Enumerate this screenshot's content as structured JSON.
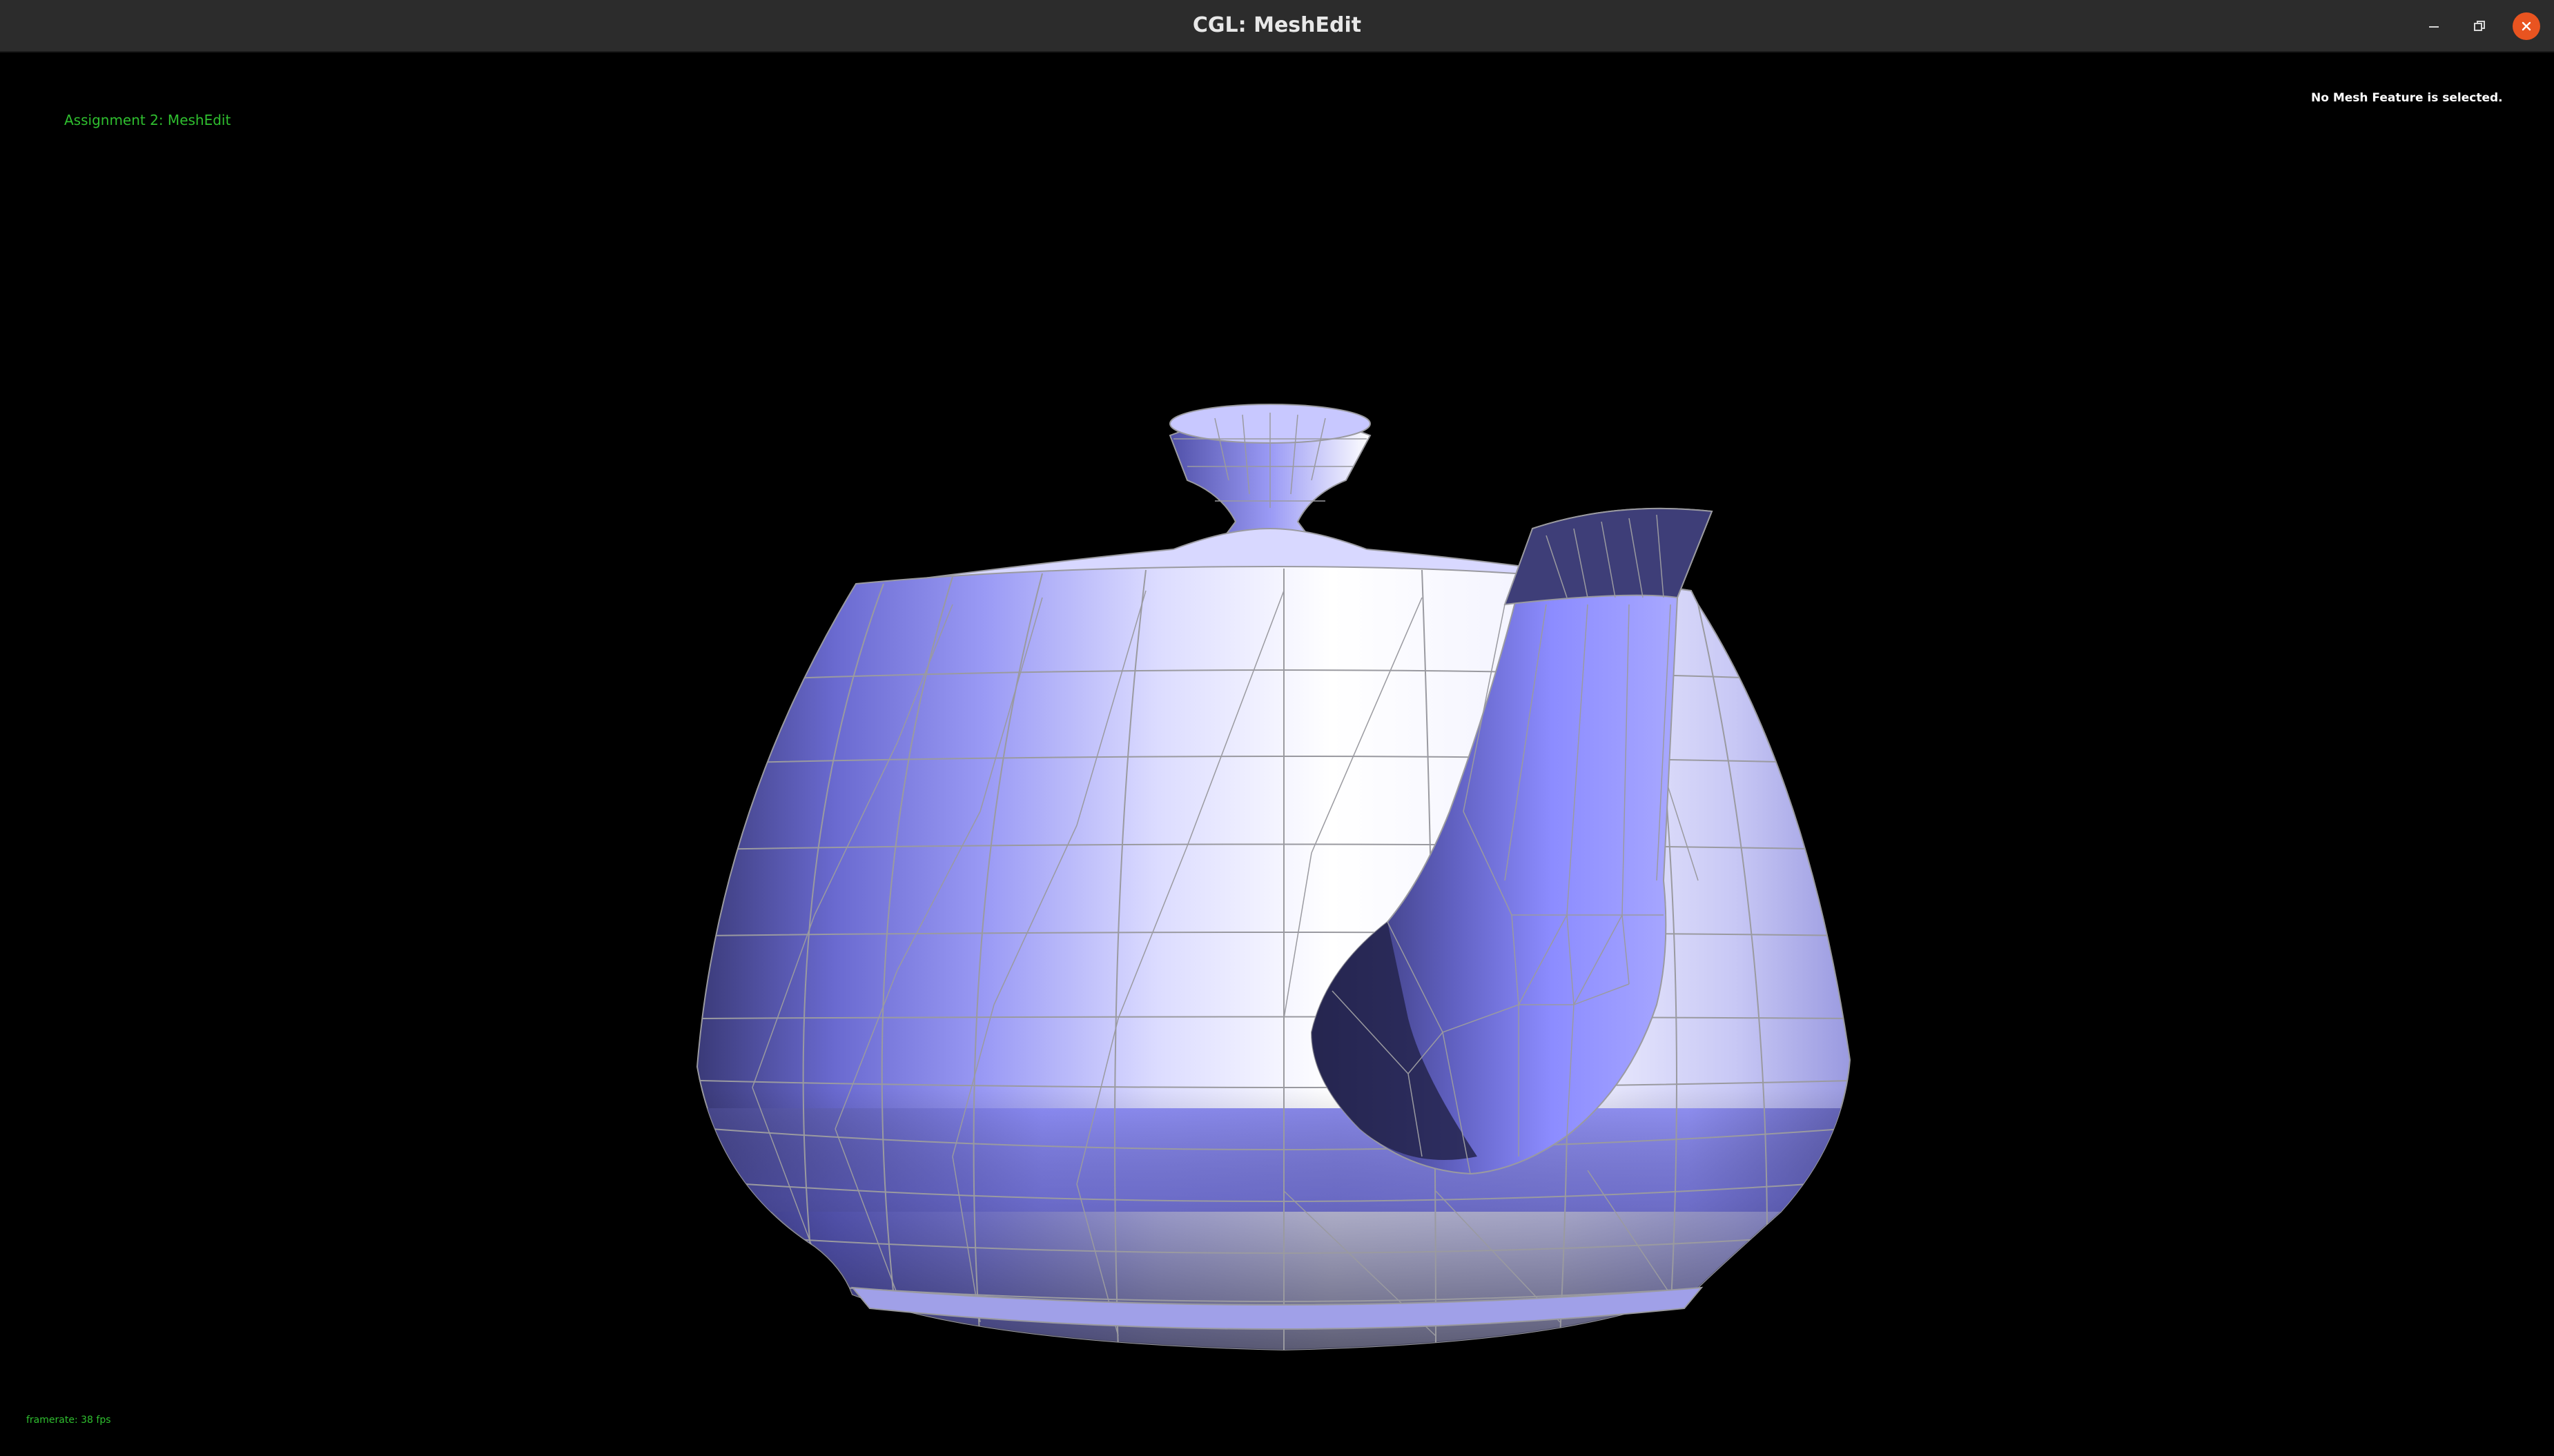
{
  "window": {
    "title": "CGL: MeshEdit",
    "controls": {
      "minimize_icon": "minimize-icon",
      "maximize_icon": "restore-icon",
      "close_icon": "close-icon",
      "close_color": "#e95420"
    }
  },
  "viewport": {
    "background": "#000000",
    "assignment_label": "Assignment 2: MeshEdit",
    "selection_status": "No Mesh Feature is selected.",
    "framerate": "framerate: 38 fps",
    "label_color": "#2fbf2f"
  },
  "mesh": {
    "object": "teapot",
    "render_mode": "shaded-wireframe",
    "base_color": "#8c8cff",
    "wire_color": "#9a9aa0"
  }
}
